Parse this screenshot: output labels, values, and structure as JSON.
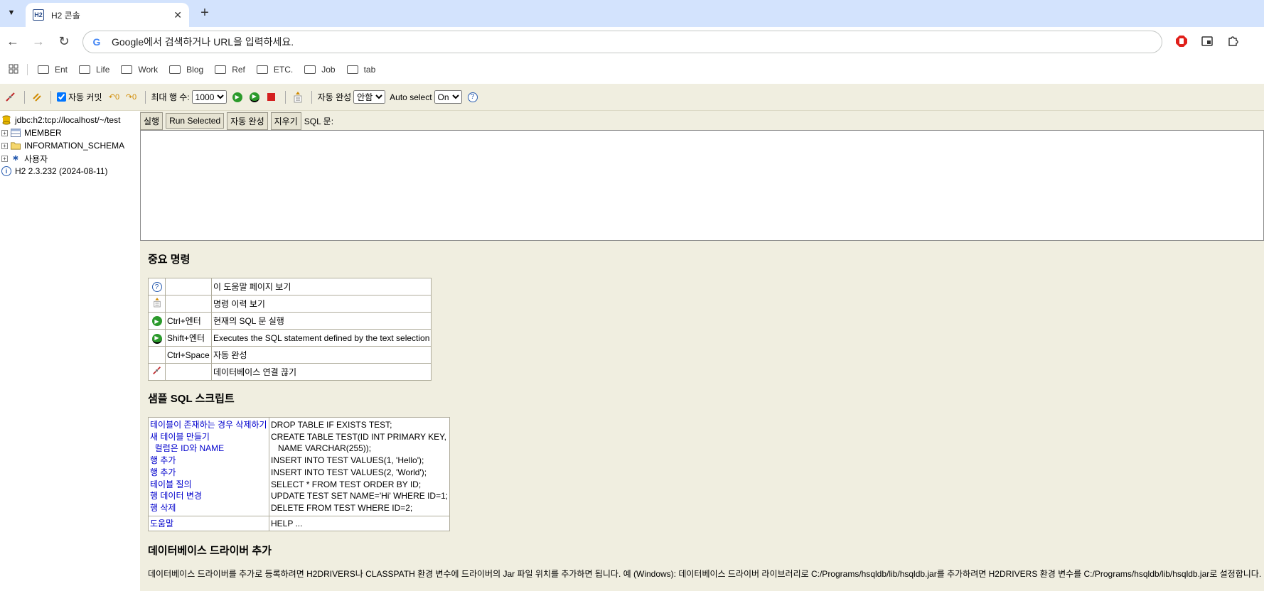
{
  "browser": {
    "tab_title": "H2 콘솔",
    "favicon_text": "H2",
    "omnibox_placeholder": "Google에서 검색하거나 URL을 입력하세요.",
    "bookmarks": [
      "Ent",
      "Life",
      "Work",
      "Blog",
      "Ref",
      "ETC.",
      "Job",
      "tab"
    ]
  },
  "h2toolbar": {
    "autocommit_label": "자동 커밋",
    "maxrows_label": "최대 행 수:",
    "maxrows_value": "1000",
    "autocomplete_label": "자동 완성",
    "autocomplete_value": "안함",
    "autoselect_label": "Auto select",
    "autoselect_value": "On"
  },
  "tree": {
    "connection": "jdbc:h2:tcp://localhost/~/test",
    "items": [
      "MEMBER",
      "INFORMATION_SCHEMA",
      "사용자"
    ],
    "version": "H2 2.3.232 (2024-08-11)"
  },
  "sqlbar": {
    "run": "실행",
    "run_selected": "Run Selected",
    "autocomplete": "자동 완성",
    "clear": "지우기",
    "sql_label": "SQL 문:"
  },
  "help": {
    "heading_commands": "중요 명령",
    "commands": [
      {
        "key": "",
        "desc": "이 도움말 페이지 보기"
      },
      {
        "key": "",
        "desc": "명령 이력 보기"
      },
      {
        "key": "Ctrl+엔터",
        "desc": "현재의 SQL 문 실행"
      },
      {
        "key": "Shift+엔터",
        "desc": "Executes the SQL statement defined by the text selection"
      },
      {
        "key": "Ctrl+Space",
        "desc": "자동 완성"
      },
      {
        "key": "",
        "desc": "데이터베이스 연결 끊기"
      }
    ],
    "heading_samples": "샘플 SQL 스크립트",
    "samples": [
      {
        "label": "테이블이 존재하는 경우 삭제하기",
        "sql": "DROP TABLE IF EXISTS TEST;"
      },
      {
        "label": "새 테이블 만들기",
        "sql": "CREATE TABLE TEST(ID INT PRIMARY KEY,"
      },
      {
        "label": "  컬럼은 ID와 NAME",
        "sql": "   NAME VARCHAR(255));"
      },
      {
        "label": "행 추가",
        "sql": "INSERT INTO TEST VALUES(1, 'Hello');"
      },
      {
        "label": "행 추가",
        "sql": "INSERT INTO TEST VALUES(2, 'World');"
      },
      {
        "label": "테이블 질의",
        "sql": "SELECT * FROM TEST ORDER BY ID;"
      },
      {
        "label": "행 데이터 변경",
        "sql": "UPDATE TEST SET NAME='Hi' WHERE ID=1;"
      },
      {
        "label": "행 삭제",
        "sql": "DELETE FROM TEST WHERE ID=2;"
      }
    ],
    "help_label": "도움말",
    "help_sql": "HELP ...",
    "heading_drivers": "데이터베이스 드라이버 추가",
    "drivers_text": "데이터베이스 드라이버를 추가로 등록하려면 H2DRIVERS나 CLASSPATH 환경 변수에 드라이버의 Jar 파일 위치를 추가하면 됩니다. 예 (Windows): 데이터베이스 드라이버 라이브러리로 C:/Programs/hsqldb/lib/hsqldb.jar를 추가하려면 H2DRIVERS 환경 변수를 C:/Programs/hsqldb/lib/hsqldb.jar로 설정합니다."
  }
}
